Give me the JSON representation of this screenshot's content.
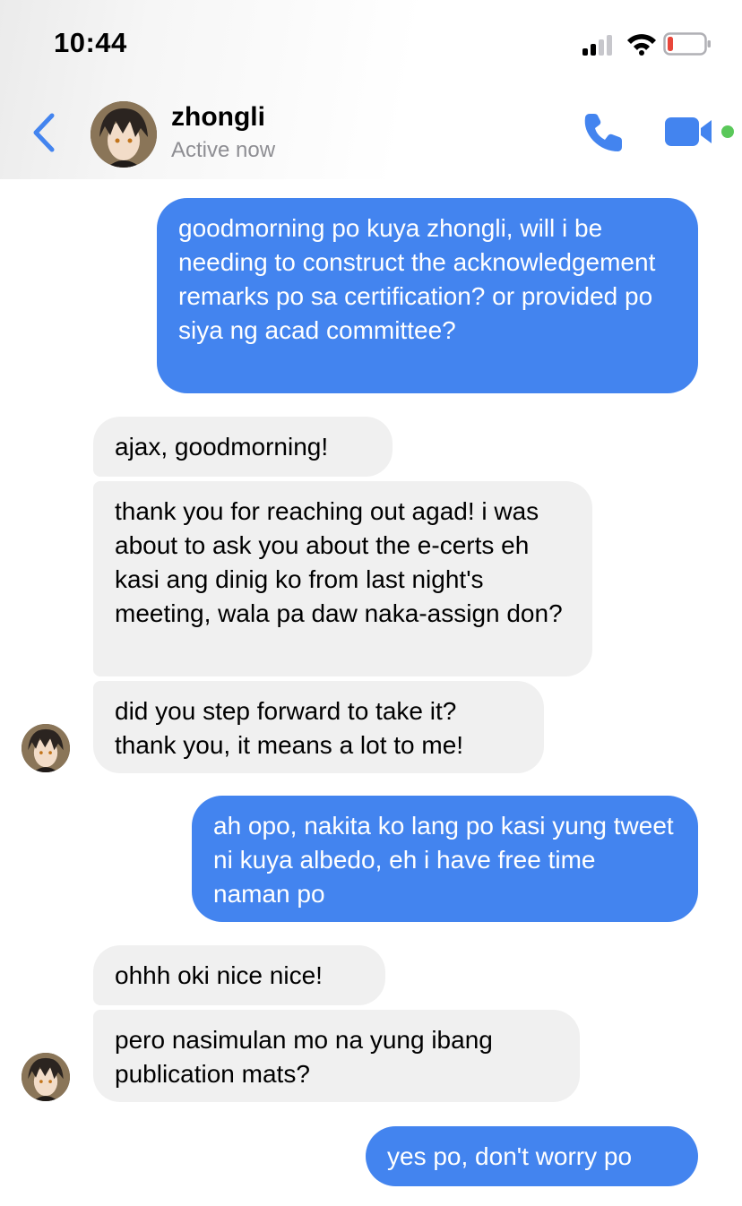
{
  "status_bar": {
    "time": "10:44",
    "battery_color": "#e8463a"
  },
  "header": {
    "back_icon": "chevron-left-icon",
    "contact_name": "zhongli",
    "contact_status": "Active now",
    "call_icon": "phone-icon",
    "video_icon": "video-camera-icon",
    "accent_color": "#4384ef",
    "online_color": "#5ac85a"
  },
  "messages": [
    {
      "direction": "sent",
      "text": "goodmorning po kuya zhongli, will i be needing to construct the acknowledgement remarks po sa certification? or provided po siya ng acad committee?"
    },
    {
      "direction": "received",
      "text": "ajax, goodmorning!"
    },
    {
      "direction": "received",
      "text": "thank you for reaching out agad! i was about to ask you about the e-certs eh kasi ang dinig ko from last night's meeting, wala pa daw naka-assign don?"
    },
    {
      "direction": "received",
      "text": "did you step forward to take it? thank you, it means a lot to me!"
    },
    {
      "direction": "sent",
      "text": "ah opo, nakita ko lang po kasi yung tweet ni kuya albedo, eh i have free time naman po"
    },
    {
      "direction": "received",
      "text": "ohhh oki nice nice!"
    },
    {
      "direction": "received",
      "text": "pero nasimulan mo na yung ibang publication mats?"
    },
    {
      "direction": "sent",
      "text": "yes po, don't worry po"
    }
  ]
}
